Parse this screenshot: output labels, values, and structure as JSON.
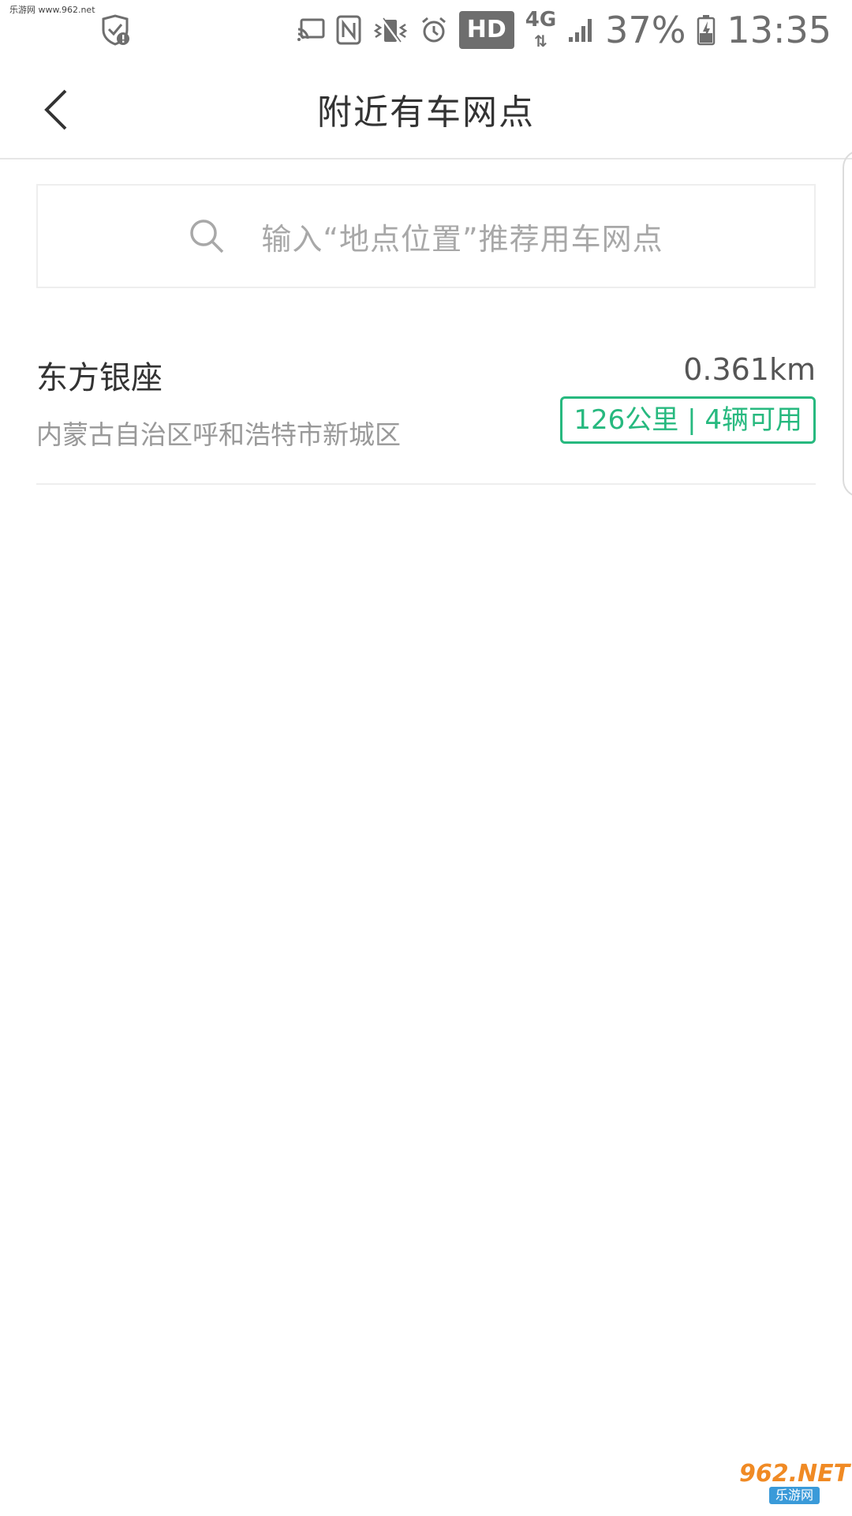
{
  "status_bar": {
    "watermark": "乐游网 www.962.net",
    "hd_label": "HD",
    "network": "4G",
    "battery": "37%",
    "time": "13:35",
    "icons": [
      "shield-alert-icon",
      "cast-icon",
      "nfc-icon",
      "vibrate-icon",
      "alarm-icon",
      "signal-icon",
      "battery-icon"
    ]
  },
  "header": {
    "title": "附近有车网点",
    "back_icon": "chevron-left-icon"
  },
  "search": {
    "placeholder": "输入“地点位置”推荐用车网点",
    "icon": "search-icon"
  },
  "stations": [
    {
      "name": "东方银座",
      "address": "内蒙古自治区呼和浩特市新城区",
      "distance": "0.361km",
      "availability": "126公里 | 4辆可用"
    }
  ],
  "colors": {
    "accent": "#27b97f",
    "title_text": "#333333",
    "secondary_text": "#999999",
    "placeholder_text": "#a8a8a8",
    "divider": "#eeeeee"
  },
  "watermark_bottom": {
    "logo": "962.NET",
    "sub": "乐游网"
  }
}
